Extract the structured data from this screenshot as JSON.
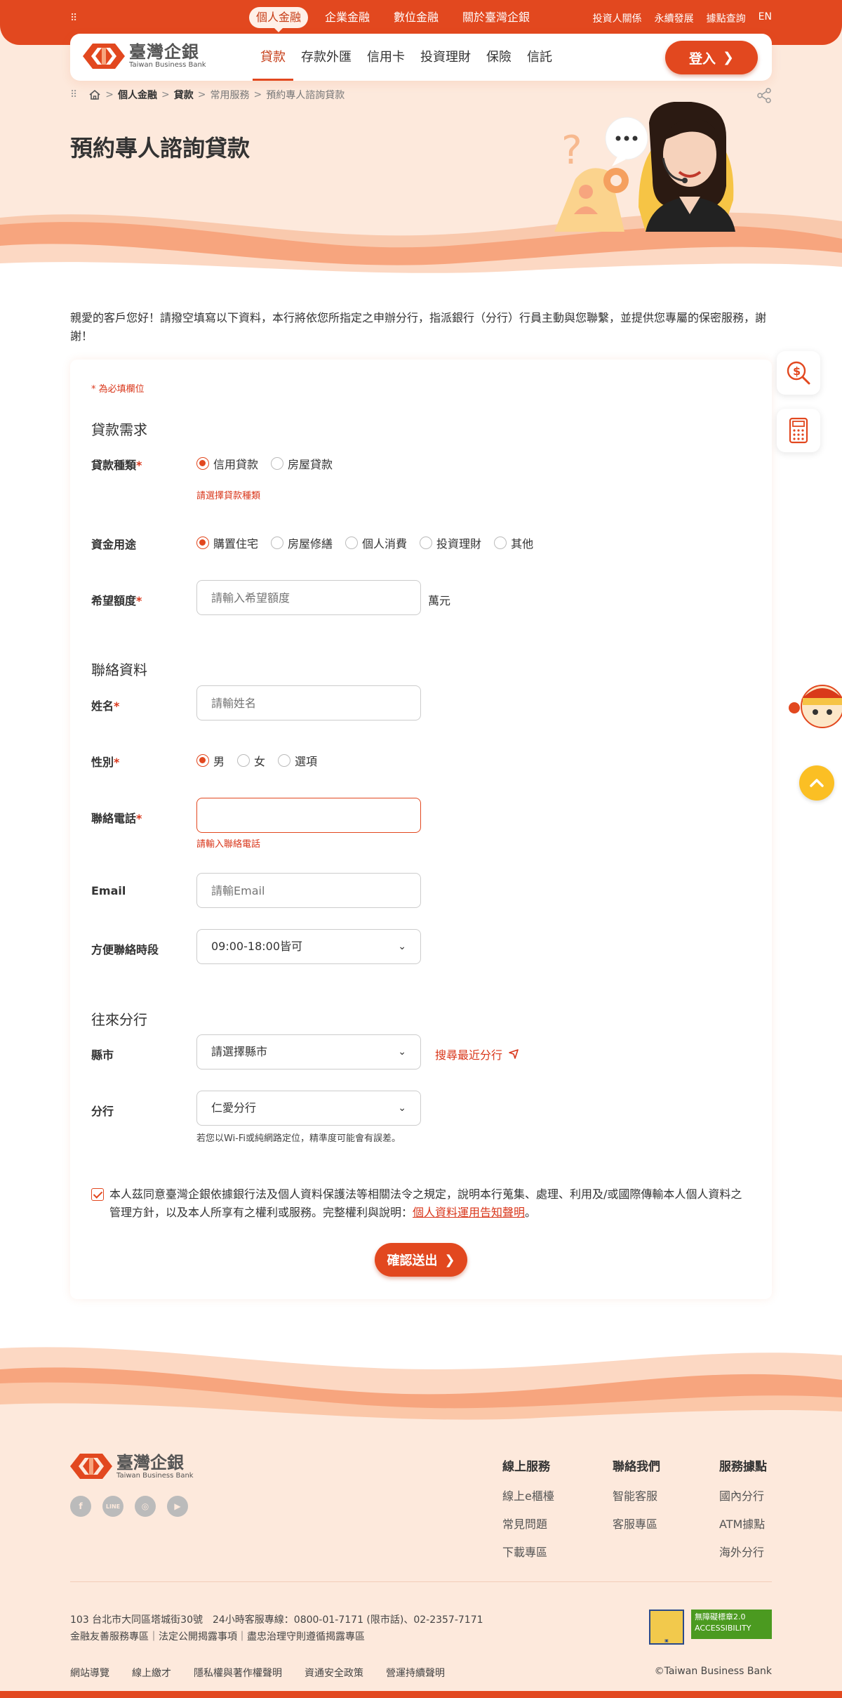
{
  "topbar": {
    "nav": [
      "個人金融",
      "企業金融",
      "數位金融",
      "關於臺灣企銀"
    ],
    "links": [
      "投資人關係",
      "永續發展",
      "據點查詢",
      "EN"
    ]
  },
  "brand": {
    "name_cn": "臺灣企銀",
    "name_en": "Taiwan Business Bank"
  },
  "mainnav": [
    "貸款",
    "存款外匯",
    "信用卡",
    "投資理財",
    "保險",
    "信託"
  ],
  "login_label": "登入",
  "breadcrumb": {
    "l1": "個人金融",
    "l2": "貸款",
    "l3": "常用服務",
    "l4": "預約專人諮詢貸款"
  },
  "page_title": "預約專人諮詢貸款",
  "intro": "親愛的客戶您好！請撥空填寫以下資料，本行將依您所指定之申辦分行，指派銀行（分行）行員主動與您聯繫，並提供您專屬的保密服務，謝謝！",
  "form": {
    "required_note": "* 為必填欄位",
    "section_loan": "貸款需求",
    "loan_type": {
      "label": "貸款種類",
      "options": [
        "信用貸款",
        "房屋貸款"
      ],
      "selected": 0,
      "error": "請選擇貸款種類"
    },
    "purpose": {
      "label": "資金用途",
      "options": [
        "購置住宅",
        "房屋修繕",
        "個人消費",
        "投資理財",
        "其他"
      ],
      "selected": 0
    },
    "amount": {
      "label": "希望額度",
      "placeholder": "請輸入希望額度",
      "unit": "萬元"
    },
    "section_contact": "聯絡資料",
    "name": {
      "label": "姓名",
      "placeholder": "請輸姓名"
    },
    "gender": {
      "label": "性別",
      "options": [
        "男",
        "女",
        "選項"
      ],
      "selected": 0
    },
    "phone": {
      "label": "聯絡電話",
      "value": "",
      "error": "請輸入聯絡電話"
    },
    "email": {
      "label": "Email",
      "placeholder": "請輸Email"
    },
    "time": {
      "label": "方便聯絡時段",
      "value": "09:00-18:00皆可"
    },
    "section_branch": "往來分行",
    "county": {
      "label": "縣市",
      "value": "請選擇縣市",
      "nearest": "搜尋最近分行"
    },
    "branch": {
      "label": "分行",
      "value": "仁愛分行",
      "hint": "若您以Wi-Fi或純網路定位，精準度可能會有誤差。"
    },
    "consent_text": "本人茲同意臺灣企銀依據銀行法及個人資料保護法等相關法令之規定，說明本行蒐集、處理、利用及/或國際傳輸本人個人資料之管理方針，以及本人所享有之權利或服務。完整權利與說明：",
    "consent_link": "個人資料運用告知聲明",
    "consent_end": "。",
    "submit": "確認送出"
  },
  "footer": {
    "col1": {
      "title": "線上服務",
      "items": [
        "線上e櫃檯",
        "常見問題",
        "下載專區"
      ]
    },
    "col2": {
      "title": "聯絡我們",
      "items": [
        "智能客服",
        "客服專區"
      ]
    },
    "col3": {
      "title": "服務據點",
      "items": [
        "國內分行",
        "ATM據點",
        "海外分行"
      ]
    },
    "address": "103 台北市大同區塔城街30號　24小時客服專線：0800-01-7171 (限市話)、02-2357-7171",
    "links1": "金融友善服務專區｜法定公開揭露事項｜盡忠治理守則遵循揭露專區",
    "links2": [
      "網站導覽",
      "線上繳才",
      "隱私權與著作權聲明",
      "資通安全政策",
      "營運持續聲明"
    ],
    "copyright": "©Taiwan Business Bank",
    "badge": "無障礙標章2.0"
  },
  "colors": {
    "brand": "#e2481f",
    "hero_bg": "#fde9dc",
    "error": "#d9361a"
  }
}
